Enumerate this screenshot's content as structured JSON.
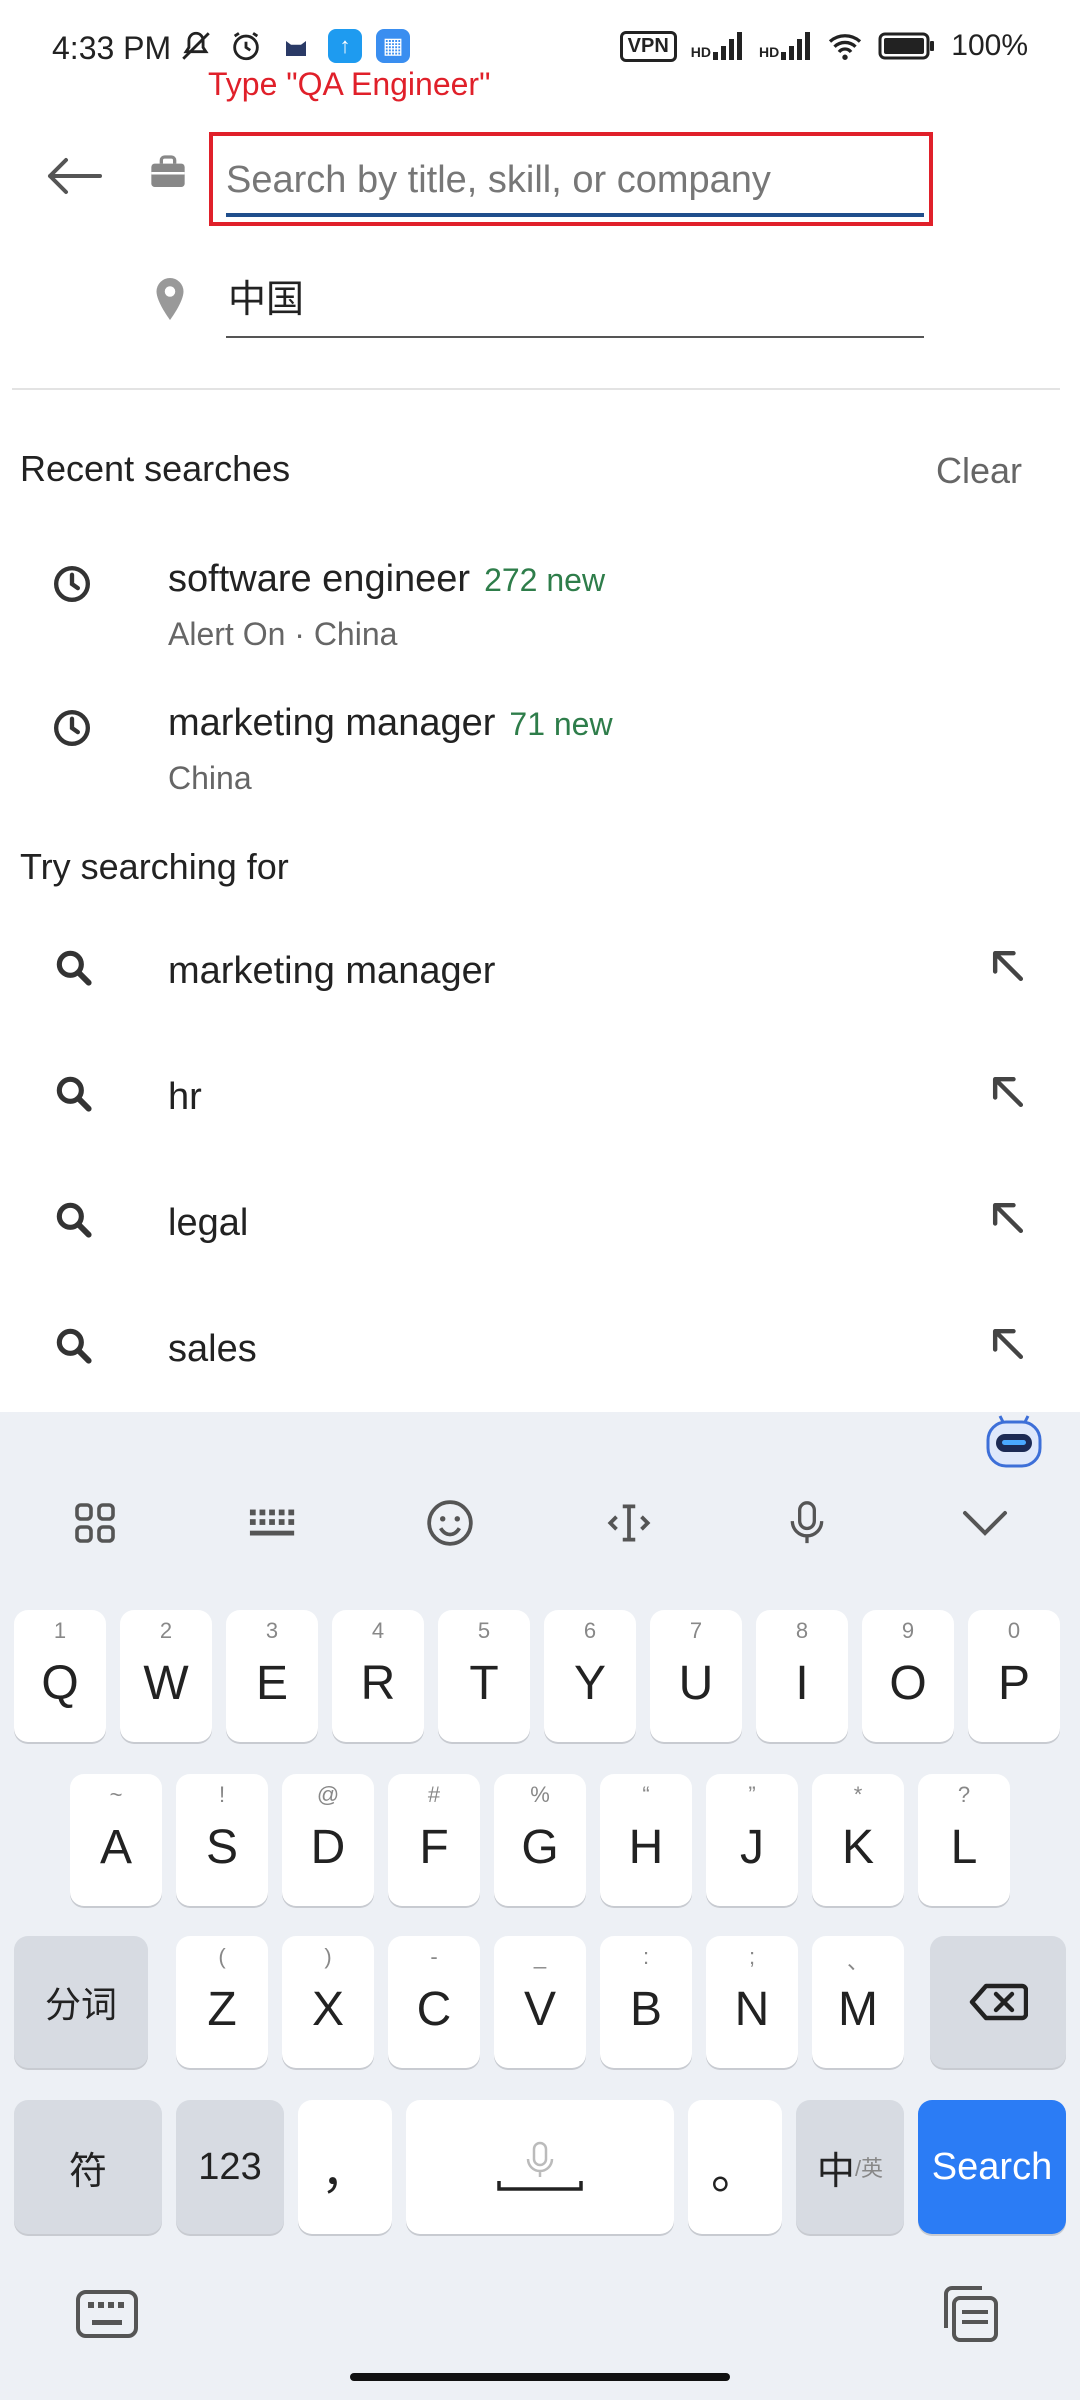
{
  "status_bar": {
    "time": "4:33 PM",
    "vpn": "VPN",
    "battery": "100%",
    "hd1": "HD",
    "hd2": "HD"
  },
  "instruction": "Type \"QA Engineer\"",
  "search": {
    "placeholder": "Search by title, skill, or company",
    "value": ""
  },
  "location": {
    "value": "中国"
  },
  "recent": {
    "title": "Recent searches",
    "clear_label": "Clear",
    "items": [
      {
        "title": "software engineer",
        "new_count": "272 new",
        "sub": "Alert On · China"
      },
      {
        "title": "marketing manager",
        "new_count": "71 new",
        "sub": "China"
      }
    ]
  },
  "suggestions": {
    "title": "Try searching for",
    "items": [
      {
        "label": "marketing manager"
      },
      {
        "label": "hr"
      },
      {
        "label": "legal"
      },
      {
        "label": "sales"
      }
    ]
  },
  "keyboard": {
    "row1": [
      {
        "k": "Q",
        "h": "1"
      },
      {
        "k": "W",
        "h": "2"
      },
      {
        "k": "E",
        "h": "3"
      },
      {
        "k": "R",
        "h": "4"
      },
      {
        "k": "T",
        "h": "5"
      },
      {
        "k": "Y",
        "h": "6"
      },
      {
        "k": "U",
        "h": "7"
      },
      {
        "k": "I",
        "h": "8"
      },
      {
        "k": "O",
        "h": "9"
      },
      {
        "k": "P",
        "h": "0"
      }
    ],
    "row2": [
      {
        "k": "A",
        "h": "~"
      },
      {
        "k": "S",
        "h": "!"
      },
      {
        "k": "D",
        "h": "@"
      },
      {
        "k": "F",
        "h": "#"
      },
      {
        "k": "G",
        "h": "%"
      },
      {
        "k": "H",
        "h": "“"
      },
      {
        "k": "J",
        "h": "”"
      },
      {
        "k": "K",
        "h": "*"
      },
      {
        "k": "L",
        "h": "?"
      }
    ],
    "row3": [
      {
        "k": "Z",
        "h": "("
      },
      {
        "k": "X",
        "h": ")"
      },
      {
        "k": "C",
        "h": "-"
      },
      {
        "k": "V",
        "h": "_"
      },
      {
        "k": "B",
        "h": ":"
      },
      {
        "k": "N",
        "h": ";"
      },
      {
        "k": "M",
        "h": "、"
      }
    ],
    "fenci": "分词",
    "fu": "符",
    "num": "123",
    "comma": "，",
    "period": "。",
    "lang_main": "中",
    "lang_sub": "/英",
    "search_label": "Search"
  },
  "colors": {
    "accent_blue": "#2b7cf5",
    "new_green": "#2e7d4a",
    "highlight_red": "#e0202a"
  }
}
